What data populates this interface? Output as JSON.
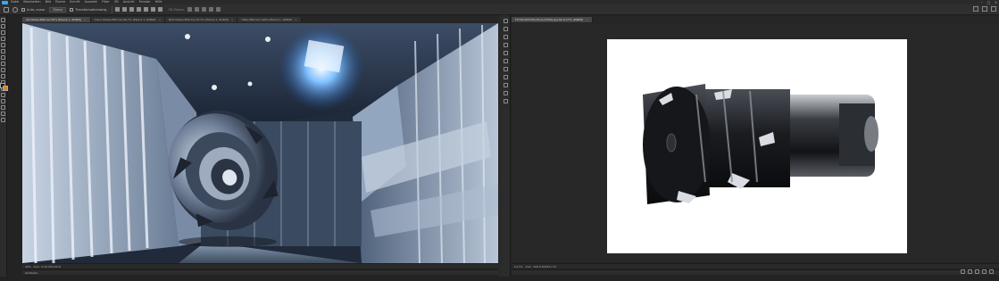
{
  "menu": {
    "items": [
      "Datei",
      "Bearbeiten",
      "Bild",
      "Ebene",
      "Schrift",
      "Auswahl",
      "Filter",
      "3D",
      "Ansicht",
      "Fenster",
      "Hilfe"
    ]
  },
  "options": {
    "auto_select": "Auto.-ausw.:",
    "layer_dropdown": "Ebene",
    "transform_controls": "Transformationsstrg.",
    "mode_3d": "3D-Modus:"
  },
  "left_doc": {
    "tabs": [
      "AG Messe.PNG bei 50% (Ebene 1, RGB/8)",
      "Gleco Messe.PNG bei 66,7% (Ebene 1, RGB/8)",
      "BGS Messe.PNG bei 33,3% (Ebene 1, RGB/8)",
      "Halle.PNG bei 100% (Ebene 1, RGB/8)"
    ],
    "zoom": "49%",
    "doc_info": "Dok.: 5,49 M/5,49 M",
    "panel_label": "Zeitleiste"
  },
  "right_doc": {
    "tab": "FX700-SATYCM_Final-[1500].jpg bei 6,17% (RGB/8)",
    "zoom": "6,17%",
    "doc_info": "Dok.: 306,6 M/635,2 M"
  },
  "colors": {
    "foreground": "#111111",
    "background": "#e8820d",
    "accent": "#31a8ff"
  }
}
